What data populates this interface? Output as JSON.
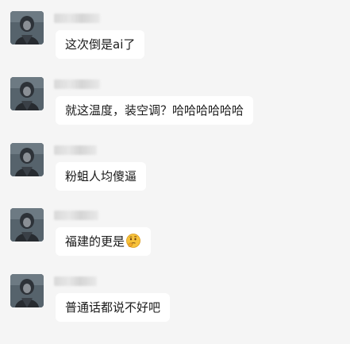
{
  "messages": [
    {
      "text": "这次倒是ai了",
      "avatar_icon": "person-avatar-icon"
    },
    {
      "text": "就这温度，装空调？哈哈哈哈哈哈",
      "avatar_icon": "person-avatar-icon"
    },
    {
      "text": "粉蛆人均傻逼",
      "avatar_icon": "person-avatar-icon"
    },
    {
      "text": "福建的更是",
      "avatar_icon": "person-avatar-icon",
      "emoji": "thinking-face-icon"
    },
    {
      "text": "普通话都说不好吧",
      "avatar_icon": "person-avatar-icon"
    }
  ],
  "colors": {
    "background": "#f5f5f5",
    "bubble": "#ffffff",
    "text": "#1a1a1a"
  }
}
